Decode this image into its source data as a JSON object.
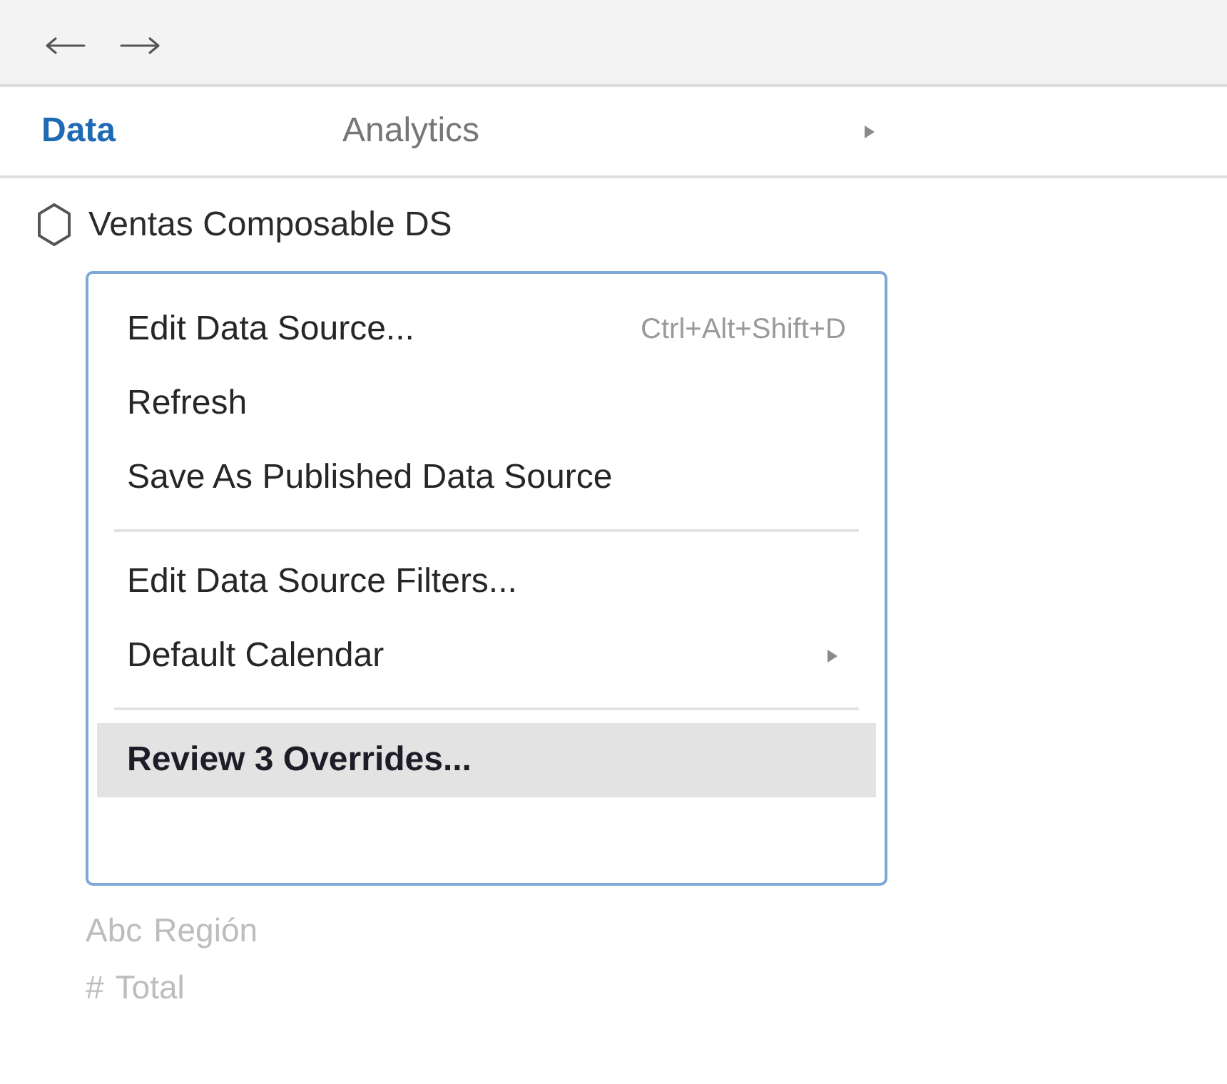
{
  "tabs": [
    {
      "label": "Data",
      "selected": true
    },
    {
      "label": "Analytics",
      "selected": false
    }
  ],
  "data_source": {
    "name": "Ventas Composable DS"
  },
  "context_menu": {
    "sections": [
      {
        "items": [
          {
            "label": "Edit Data Source...",
            "shortcut": "Ctrl+Alt+Shift+D",
            "submenu": false,
            "highlighted": false,
            "bold": false
          },
          {
            "label": "Refresh",
            "submenu": false,
            "highlighted": false,
            "bold": false
          },
          {
            "label": "Save As Published Data Source",
            "submenu": false,
            "highlighted": false,
            "bold": false
          }
        ]
      },
      {
        "items": [
          {
            "label": "Edit Data Source Filters...",
            "submenu": false,
            "highlighted": false,
            "bold": false
          },
          {
            "label": "Default Calendar",
            "submenu": true,
            "highlighted": false,
            "bold": false
          }
        ]
      },
      {
        "items": [
          {
            "label": "Review 3 Overrides...",
            "submenu": false,
            "highlighted": true,
            "bold": true
          }
        ]
      }
    ]
  },
  "fields": [
    {
      "type": "Abc",
      "name": "Región"
    },
    {
      "type": "#",
      "name": "Total"
    }
  ]
}
